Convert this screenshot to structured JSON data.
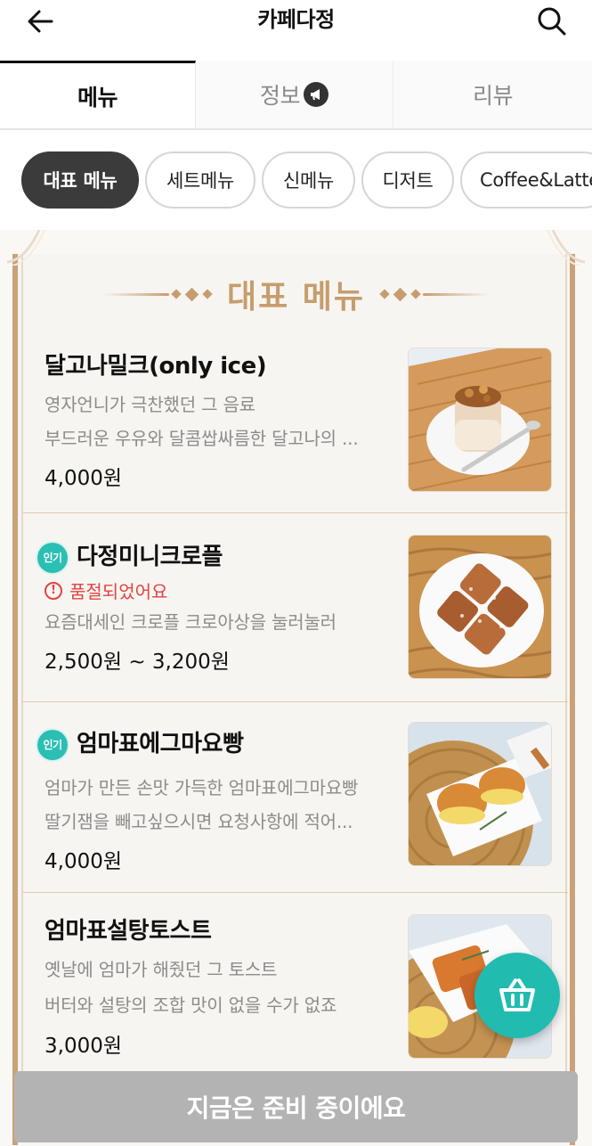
{
  "header": {
    "title": "카페다정",
    "back_icon": "arrow-left-icon",
    "search_icon": "search-icon"
  },
  "tabs": [
    {
      "label": "메뉴",
      "active": true
    },
    {
      "label": "정보",
      "active": false,
      "icon": "megaphone-icon"
    },
    {
      "label": "리뷰",
      "active": false
    }
  ],
  "categories": [
    {
      "label": "대표 메뉴",
      "active": true
    },
    {
      "label": "세트메뉴",
      "active": false
    },
    {
      "label": "신메뉴",
      "active": false
    },
    {
      "label": "디저트",
      "active": false
    },
    {
      "label": "Coffee&Latte",
      "active": false
    }
  ],
  "section": {
    "title": "대표 메뉴"
  },
  "items": [
    {
      "name": "달고나밀크(only ice)",
      "popular": false,
      "desc_1": "영자언니가 극찬했던 그 음료",
      "desc_2": "부드러운 우유와 달콤쌉싸름한 달고나의 ...",
      "price": "4,000원"
    },
    {
      "name": "다정미니크로플",
      "popular": true,
      "badge": "인기",
      "soldout": "품절되었어요",
      "desc_1": "요즘대세인 크로플 크로아상을 눌러눌러",
      "price": "2,500원 ~ 3,200원"
    },
    {
      "name": "엄마표에그마요빵",
      "popular": true,
      "badge": "인기",
      "desc_1": "엄마가 만든 손맛 가득한 엄마표에그마요빵",
      "desc_2": "딸기잼을 빼고싶으시면 요청사항에 적어...",
      "price": "4,000원"
    },
    {
      "name": "엄마표설탕토스트",
      "popular": false,
      "desc_1": "옛날에 엄마가 해줬던 그 토스트",
      "desc_2": "버터와 설탕의 조합 맛이 없을 수가 없죠",
      "price": "3,000원"
    }
  ],
  "cart_icon": "basket-icon",
  "bottom": {
    "status_label": "지금은 준비 중이에요"
  },
  "colors": {
    "accent_teal": "#22bbb0",
    "frame_gold": "#c9a27a",
    "soldout_red": "#e04343",
    "disabled_gray": "#b3b3b3"
  }
}
